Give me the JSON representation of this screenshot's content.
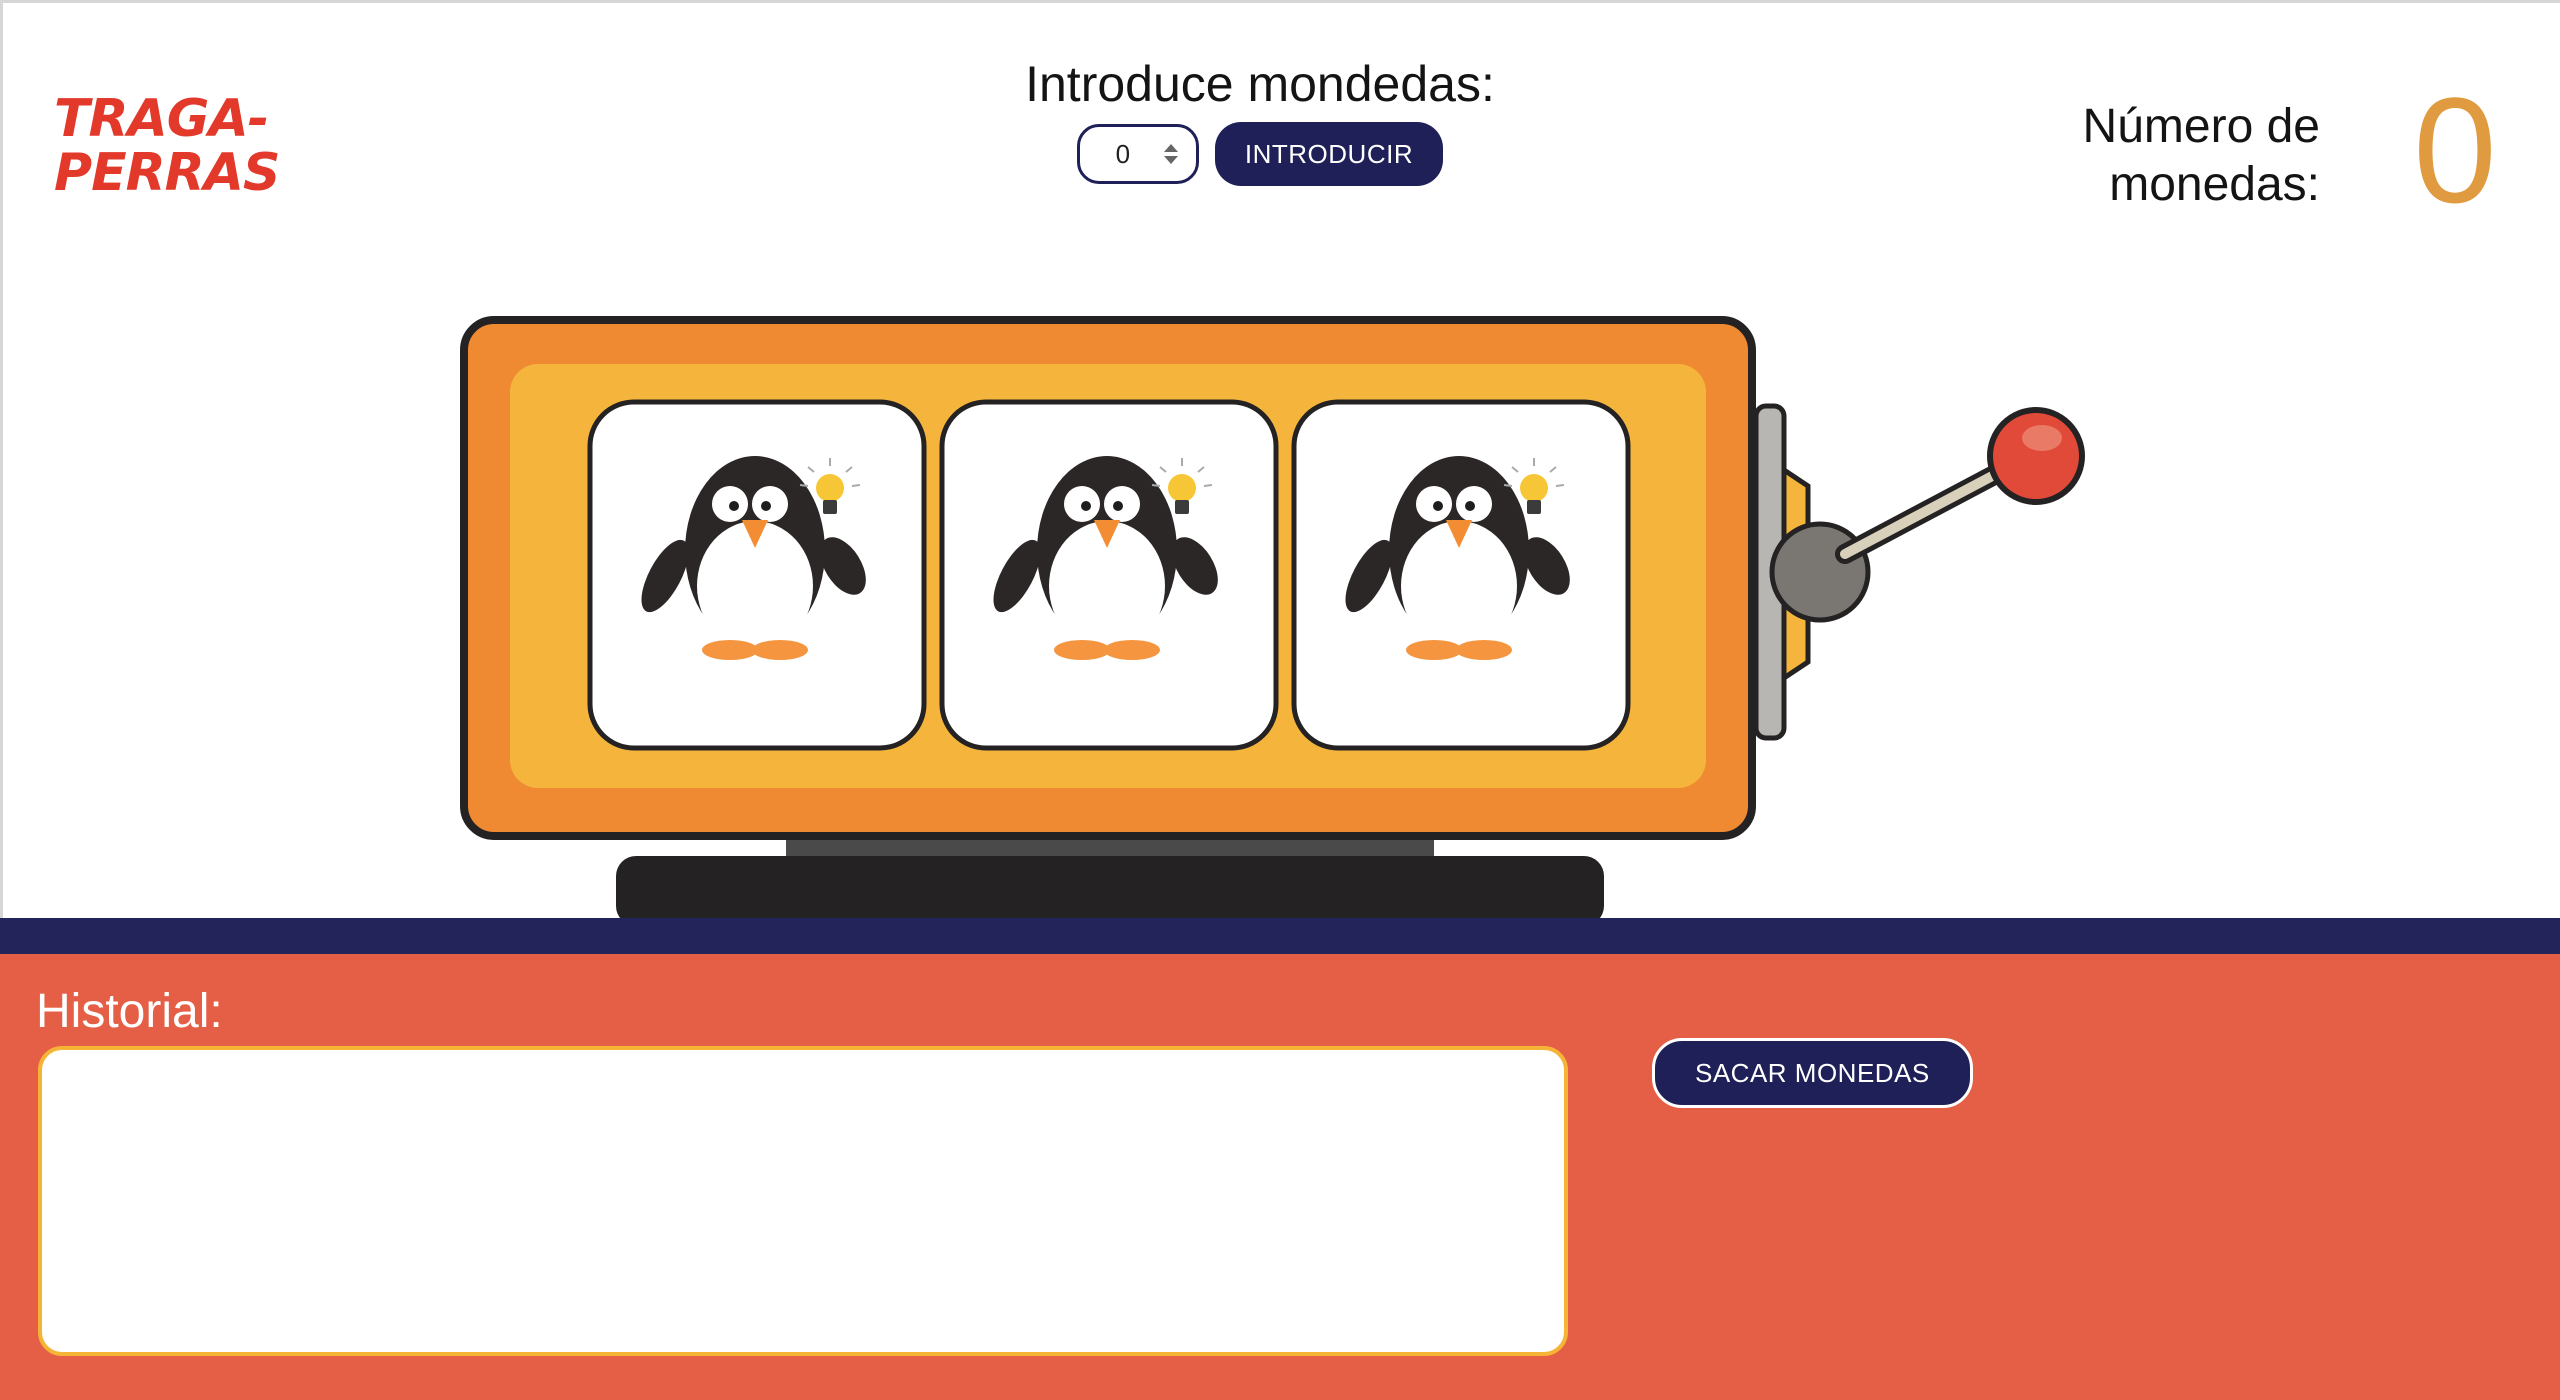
{
  "logo": {
    "line1": "TRAGA-",
    "line2": "PERRAS"
  },
  "insert": {
    "title": "Introduce mondedas:",
    "value": "0",
    "button_label": "INTRODUCIR"
  },
  "coins": {
    "label_line1": "Número de",
    "label_line2": "monedas:",
    "count": "0"
  },
  "reels": [
    {
      "symbol": "penguin-with-lightbulb"
    },
    {
      "symbol": "penguin-with-lightbulb"
    },
    {
      "symbol": "penguin-with-lightbulb"
    }
  ],
  "history": {
    "label": "Historial:",
    "content": ""
  },
  "withdraw": {
    "button_label": "SACAR MONEDAS"
  },
  "colors": {
    "logo": "#e2392b",
    "navy": "#1f2057",
    "coin_count": "#e09a3f",
    "machine_outer": "#f08a32",
    "machine_inner": "#f5b53c",
    "bottom_panel": "#e45f45",
    "history_border": "#f5b436"
  }
}
